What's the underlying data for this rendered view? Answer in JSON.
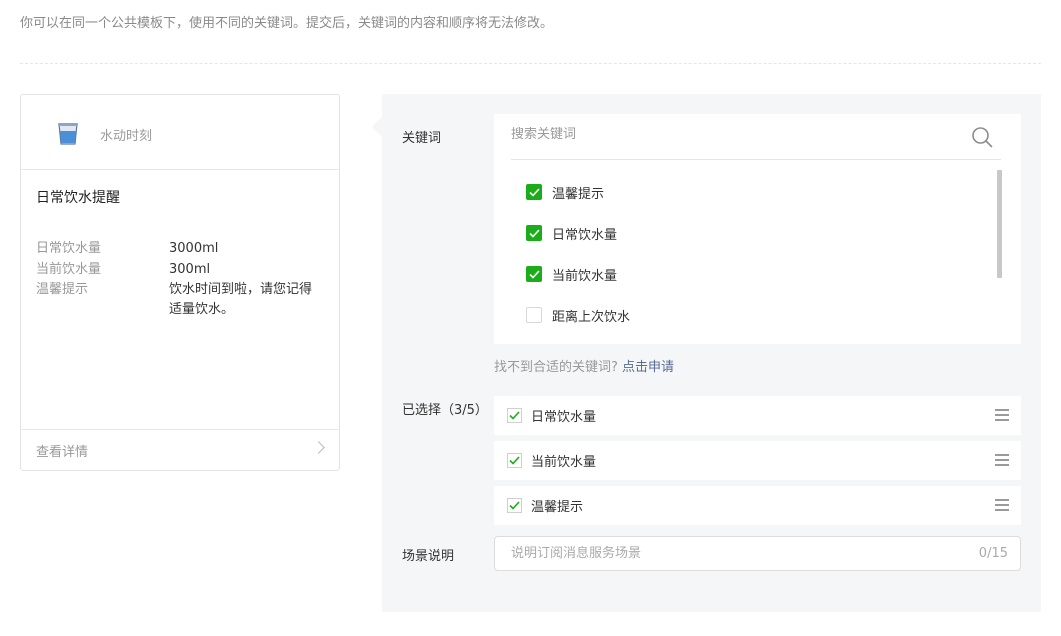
{
  "notice": "你可以在同一个公共模板下，使用不同的关键词。提交后，关键词的内容和顺序将无法修改。",
  "preview": {
    "app_name": "水动时刻",
    "title": "日常饮水提醒",
    "fields": [
      {
        "key": "日常饮水量",
        "value": "3000ml"
      },
      {
        "key": "当前饮水量",
        "value": "300ml"
      },
      {
        "key": "温馨提示",
        "value": "饮水时间到啦，请您记得适量饮水。"
      }
    ],
    "detail_label": "查看详情"
  },
  "keywords": {
    "label": "关键词",
    "search_placeholder": "搜索关键词",
    "options": [
      {
        "label": "温馨提示",
        "checked": true
      },
      {
        "label": "日常饮水量",
        "checked": true
      },
      {
        "label": "当前饮水量",
        "checked": true
      },
      {
        "label": "距离上次饮水",
        "checked": false
      }
    ],
    "hint_text": "找不到合适的关键词?",
    "apply_link": "点击申请"
  },
  "selected": {
    "label": "已选择（3/5）",
    "items": [
      "日常饮水量",
      "当前饮水量",
      "温馨提示"
    ]
  },
  "scene": {
    "label": "场景说明",
    "placeholder": "说明订阅消息服务场景",
    "counter": "0/15"
  },
  "colors": {
    "accent_green": "#1aad19",
    "link_blue": "#576b95"
  }
}
